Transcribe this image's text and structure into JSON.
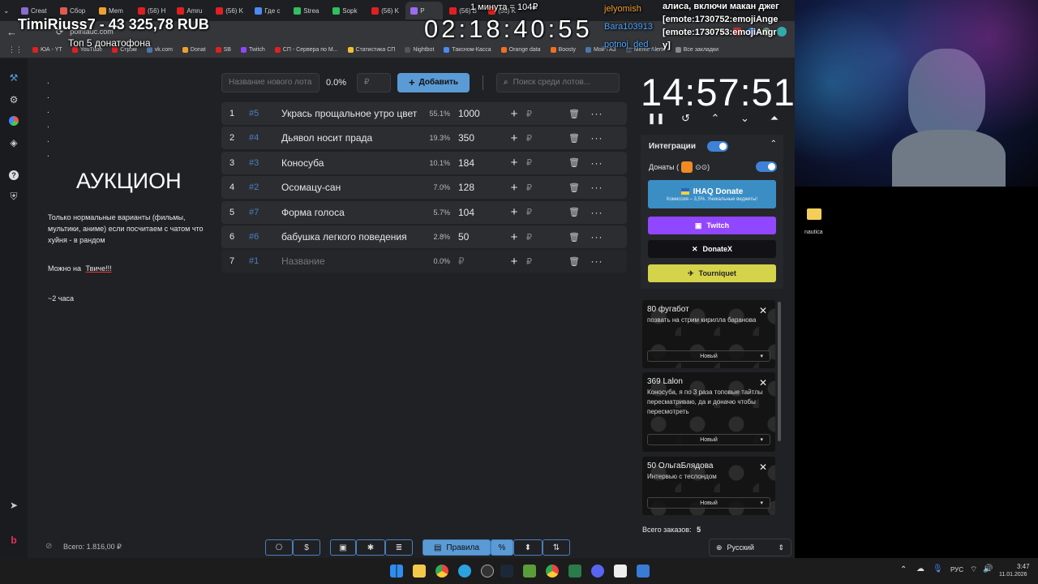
{
  "browser": {
    "tabs": [
      {
        "label": "Creat",
        "color": "#8a6bd1"
      },
      {
        "label": "Сбор",
        "color": "#e05a4f"
      },
      {
        "label": "Mem",
        "color": "#f0a030"
      },
      {
        "label": "(56) H",
        "color": "#e02020"
      },
      {
        "label": "Amru",
        "color": "#e02020"
      },
      {
        "label": "(56) K",
        "color": "#e02020"
      },
      {
        "label": "Где с",
        "color": "#4a8af4"
      },
      {
        "label": "Strea",
        "color": "#30c060"
      },
      {
        "label": "Sopk",
        "color": "#30c060"
      },
      {
        "label": "(56) K",
        "color": "#e02020"
      },
      {
        "label": "P",
        "color": "#9a6cf0"
      },
      {
        "label": "(56) B",
        "color": "#e02020"
      },
      {
        "label": "(56) K",
        "color": "#e02020"
      }
    ],
    "url": "pointauc.com",
    "bookmarks": [
      {
        "label": "ЮА - YT",
        "color": "#e02020"
      },
      {
        "label": "YouTube",
        "color": "#e02020"
      },
      {
        "label": "Стрэм",
        "color": "#e02020"
      },
      {
        "label": "vk.com",
        "color": "#4a76a8"
      },
      {
        "label": "Donat",
        "color": "#f0a030"
      },
      {
        "label": "SB",
        "color": "#e02020"
      },
      {
        "label": "Twitch",
        "color": "#9146ff"
      },
      {
        "label": "СП - Сервера по М...",
        "color": "#e02020"
      },
      {
        "label": "Статистика СП",
        "color": "#f0c030"
      },
      {
        "label": "Nightbot",
        "color": "#555"
      },
      {
        "label": "Таксном-Касса",
        "color": "#4a8af4"
      },
      {
        "label": "Orange data",
        "color": "#f07020"
      },
      {
        "label": "Boosty",
        "color": "#f07020"
      },
      {
        "label": "Мой ГАЗ",
        "color": "#4a76a8"
      },
      {
        "label": "Meme Alerts",
        "color": "#555"
      },
      {
        "label": "Все закладки",
        "color": "#888"
      }
    ]
  },
  "overlay": {
    "donation_total": "TimiRiuss7 - 43 325,78 RUB",
    "top_label": "Топ 5 донатофона",
    "big_timer": "02:18:40:55",
    "minute_info": "1 минута = 104₽",
    "chat_users": [
      "jelyomish",
      "Bara103913",
      "potnoj_ded_"
    ],
    "chat_lines": [
      "алиса, включи макан джег",
      "[emote:1730752:emojiAnge",
      "[emote:1730753:emojiAngr",
      "y]"
    ]
  },
  "sidebar_icons": [
    "gavel-icon",
    "settings-icon",
    "chart-icon",
    "layers-icon",
    "help-icon",
    "shield-icon",
    "telegram-icon",
    "logo-icon"
  ],
  "rules": {
    "dots": [
      ".",
      ".",
      ".",
      ".",
      ".",
      "."
    ],
    "title": "АУКЦИОН",
    "text1": "Только нормальные варианты (фильмы, мультики, аниме) если посчитаем с чатом что хуйня - в рандом",
    "text2_prefix": "Можно на",
    "text2_link": "Твиче!!!",
    "text3": "~2 часа"
  },
  "lot_input": {
    "name_placeholder": "Название нового лота",
    "percent": "0.0%",
    "amount_placeholder": "₽",
    "add_label": "Добавить",
    "search_placeholder": "Поиск среди лотов..."
  },
  "lots": [
    {
      "num": "1",
      "fid": "#5",
      "name": "Укрась прощальное утро цвет",
      "pct": "55.1%",
      "amount": "1000"
    },
    {
      "num": "2",
      "fid": "#4",
      "name": "Дьявол носит прада",
      "pct": "19.3%",
      "amount": "350"
    },
    {
      "num": "3",
      "fid": "#3",
      "name": "Коносуба",
      "pct": "10.1%",
      "amount": "184"
    },
    {
      "num": "4",
      "fid": "#2",
      "name": "Осомацу-сан",
      "pct": "7.0%",
      "amount": "128"
    },
    {
      "num": "5",
      "fid": "#7",
      "name": "Форма голоса",
      "pct": "5.7%",
      "amount": "104"
    },
    {
      "num": "6",
      "fid": "#6",
      "name": "бабушка легкого поведения",
      "pct": "2.8%",
      "amount": "50"
    },
    {
      "num": "7",
      "fid": "#1",
      "name": "Название",
      "pct": "0.0%",
      "amount": "₽"
    }
  ],
  "lot_currency": "₽",
  "timer": {
    "value": "14:57:51"
  },
  "integrations": {
    "title": "Интеграции",
    "donations_label": "Донаты (",
    "donations_suffix": ")",
    "ihaq_label": "IHAQ Donate",
    "ihaq_sub": "Комиссия – 3,5%. Уникальные виджеты!",
    "twitch_label": "Twitch",
    "donatex_label": "DonateX",
    "tourniquet_label": "Tourniquet"
  },
  "orders": [
    {
      "header": "80 фугабот",
      "message": "позвать на стрим кирилла баранова",
      "status": "Новый"
    },
    {
      "header": "369 Lalon",
      "message": "Коносуба, я по 3 раза топовые тайтлы пересматриваю, да и доначю чтобы пересмотреть",
      "status": "Новый"
    },
    {
      "header": "50 ОльгаБлядова",
      "message": "Интервью с теслондом",
      "status": "Новый"
    }
  ],
  "orders_total_label": "Всего заказов:",
  "orders_total": "5",
  "language": "Русский",
  "footer": {
    "total_label": "Всего: 1.816,00 ₽",
    "rules_button": "Правила"
  },
  "taskbar": {
    "lang": "РУС",
    "time": "3:47",
    "date": "11.01.2026"
  },
  "desktop": {
    "folder_label": "nautica"
  }
}
